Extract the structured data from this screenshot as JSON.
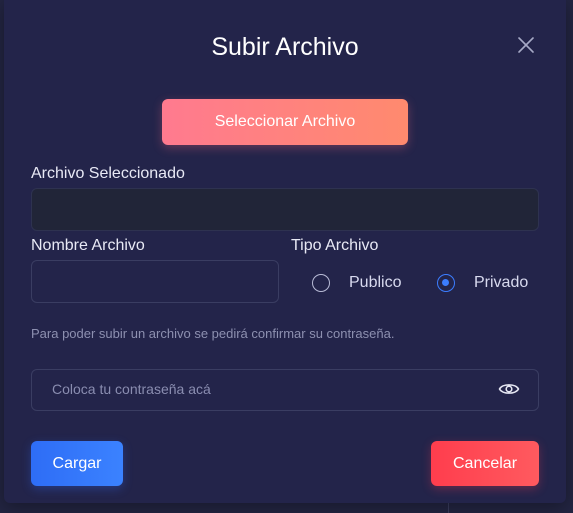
{
  "modal": {
    "title": "Subir Archivo",
    "select_file_label": "Seleccionar Archivo",
    "selected_file_label": "Archivo Seleccionado",
    "selected_file_value": "",
    "file_name_label": "Nombre Archivo",
    "file_name_value": "",
    "file_type_label": "Tipo Archivo",
    "file_type_options": [
      {
        "label": "Publico",
        "checked": false
      },
      {
        "label": "Privado",
        "checked": true
      }
    ],
    "password_hint": "Para poder subir un archivo se pedirá confirmar su contraseña.",
    "password_placeholder": "Coloca tu contraseña acá",
    "load_label": "Cargar",
    "cancel_label": "Cancelar"
  },
  "colors": {
    "modal_bg": "#23244a",
    "select_file_accent": "#ff7a8f",
    "load_accent": "#2e6df6",
    "cancel_accent": "#ff3d4d",
    "radio_checked": "#3b7dff"
  },
  "icons": {
    "close": "close-icon",
    "password_toggle": "eye-icon"
  }
}
